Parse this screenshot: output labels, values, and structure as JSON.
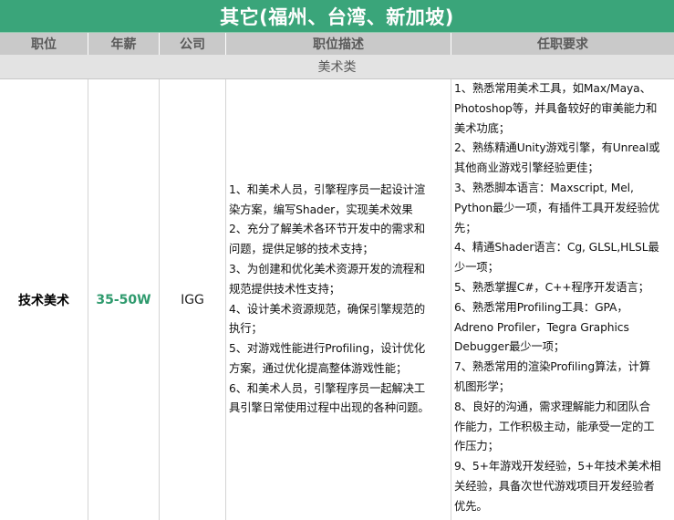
{
  "title": "其它(福州、台湾、新加坡)",
  "header": {
    "position": "职位",
    "salary": "年薪",
    "company": "公司",
    "description": "职位描述",
    "requirements": "任职要求"
  },
  "category": "美术类",
  "job": {
    "position": "技术美术",
    "salary": "35-50W",
    "company": "IGG",
    "description_lines": [
      "1、和美术人员，引擎程序员一起设计渲",
      "染方案，编写Shader，实现美术效果",
      "2、充分了解美术各环节开发中的需求和",
      "问题，提供足够的技术支持；",
      "3、为创建和优化美术资源开发的流程和",
      "规范提供技术性支持；",
      "4、设计美术资源规范，确保引擎规范的",
      "执行；",
      "5、对游戏性能进行Profiling，设计优化",
      "方案，通过优化提高整体游戏性能；",
      "6、和美术人员，引擎程序员一起解决工",
      "具引擎日常使用过程中出现的各种问题。"
    ],
    "requirement_lines": [
      "1、熟悉常用美术工具，如Max/Maya、",
      "Photoshop等，并具备较好的审美能力和",
      "美术功底；",
      "2、熟练精通Unity游戏引擎，有Unreal或",
      "其他商业游戏引擎经验更佳；",
      "3、熟悉脚本语言：Maxscript, Mel,",
      "Python最少一项，有插件工具开发经验优",
      "先；",
      "4、精通Shader语言：Cg, GLSL,HLSL最",
      "少一项；",
      "5、熟悉掌握C#，C++程序开发语言；",
      "6、熟悉常用Profiling工具：GPA，",
      "Adreno Profiler，Tegra Graphics",
      "Debugger最少一项；",
      "7、熟悉常用的渲染Profiling算法，计算",
      "机图形学；",
      "8、良好的沟通，需求理解能力和团队合",
      "作能力，工作积极主动，能承受一定的工",
      "作压力；",
      "9、5+年游戏开发经验，5+年技术美术相",
      "关经验，具备次世代游戏项目开发经验者",
      "优先。"
    ]
  },
  "colors": {
    "title_bg": "#3aa57a",
    "header_bg": "#c9c9c9",
    "category_bg": "#e3e3e3",
    "salary_text": "#2e9a6d"
  }
}
